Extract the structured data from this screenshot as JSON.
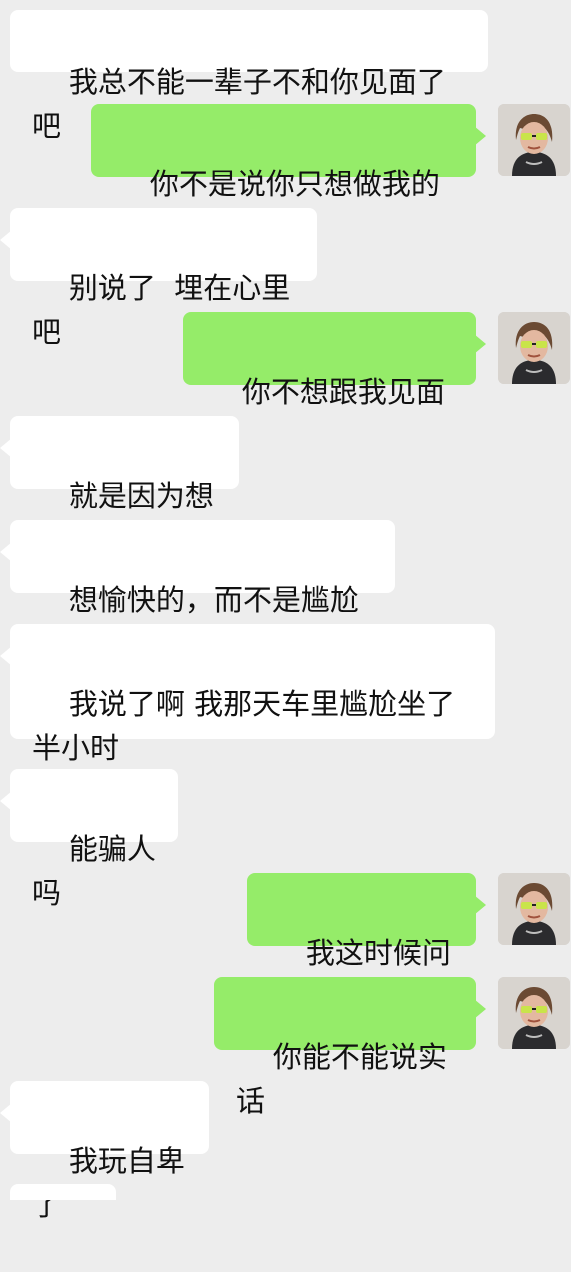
{
  "messages": [
    {
      "side": "recv",
      "text": "我总不能一辈子不和你见面了吧"
    },
    {
      "side": "sent",
      "text": "你不是说你只想做我的狗"
    },
    {
      "side": "recv",
      "text": "别说了  埋在心里吧"
    },
    {
      "side": "sent",
      "text": "你不想跟我见面吗"
    },
    {
      "side": "recv",
      "text": "就是因为想啊"
    },
    {
      "side": "recv",
      "text": "想愉快的，而不是尴尬的"
    },
    {
      "side": "recv",
      "text": "我说了啊 我那天车里尴尬坐了半小时"
    },
    {
      "side": "recv",
      "text": "能骗人吗"
    },
    {
      "side": "sent",
      "text": "我这时候问你"
    },
    {
      "side": "sent",
      "text": "你能不能说实话"
    },
    {
      "side": "recv",
      "text": "我玩自卑了"
    }
  ],
  "colors": {
    "background": "#ededed",
    "sent_bubble": "#95ec69",
    "recv_bubble": "#ffffff"
  },
  "avatar_icon": "user-avatar-sunglasses"
}
